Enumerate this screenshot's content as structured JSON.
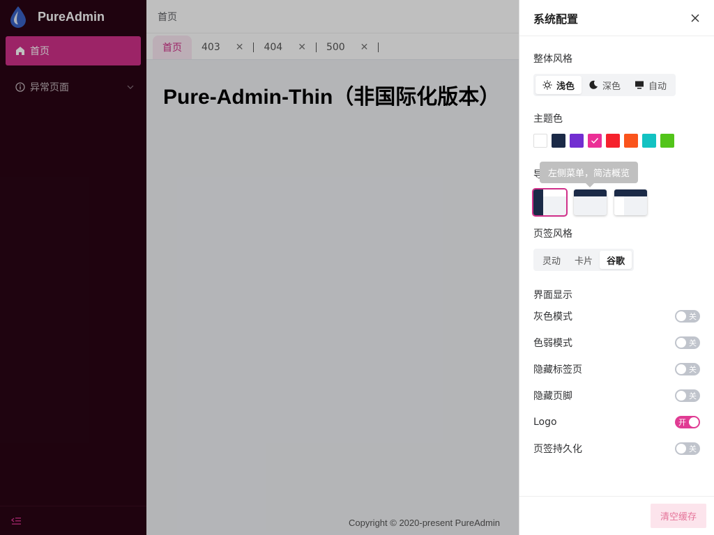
{
  "app": {
    "name": "PureAdmin"
  },
  "sidebar": {
    "items": [
      {
        "label": "首页",
        "icon": "home-icon"
      },
      {
        "label": "异常页面",
        "icon": "info-icon"
      }
    ],
    "collapse_icon": "collapse-icon"
  },
  "navbar": {
    "breadcrumb": "首页"
  },
  "tags": [
    {
      "label": "首页"
    },
    {
      "label": "403"
    },
    {
      "label": "404"
    },
    {
      "label": "500"
    }
  ],
  "content": {
    "title": "Pure-Admin-Thin（非国际化版本）"
  },
  "footer": {
    "text": "Copyright © 2020-present PureAdmin"
  },
  "panel": {
    "title": "系统配置",
    "overall_style": {
      "title": "整体风格",
      "options": [
        {
          "label": "浅色",
          "icon": "sun-icon"
        },
        {
          "label": "深色",
          "icon": "moon-icon"
        },
        {
          "label": "自动",
          "icon": "monitor-icon"
        }
      ],
      "selected": "浅色"
    },
    "theme_color": {
      "title": "主题色",
      "colors": [
        "#ffffff",
        "#1b2a47",
        "#722ed1",
        "#eb2f96",
        "#f5222d",
        "#fa541c",
        "#13c2c2",
        "#52c41a"
      ],
      "selected": "#eb2f96"
    },
    "nav_mode": {
      "title": "导航模式",
      "tooltip": "左侧菜单，简洁概览"
    },
    "tag_style": {
      "title": "页签风格",
      "options": [
        "灵动",
        "卡片",
        "谷歌"
      ],
      "selected": "谷歌"
    },
    "display": {
      "title": "界面显示",
      "switches": [
        {
          "label": "灰色模式",
          "state": "关"
        },
        {
          "label": "色弱模式",
          "state": "关"
        },
        {
          "label": "隐藏标签页",
          "state": "关"
        },
        {
          "label": "隐藏页脚",
          "state": "关"
        },
        {
          "label": "Logo",
          "state": "开"
        },
        {
          "label": "页签持久化",
          "state": "关"
        }
      ]
    },
    "clear_cache": "清空缓存"
  }
}
